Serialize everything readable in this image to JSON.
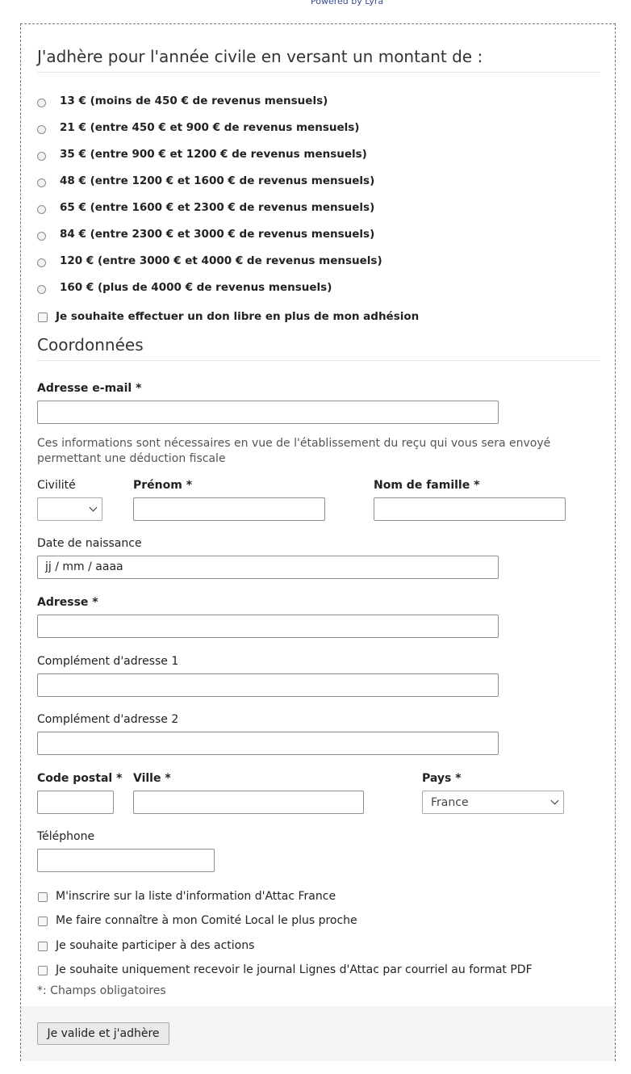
{
  "powered_by": "Powered by Lyra",
  "membership": {
    "heading": "J'adhère pour l'année civile en versant un montant de :",
    "options": [
      "13 € (moins de 450 € de revenus mensuels)",
      "21 € (entre 450 € et 900 € de revenus mensuels)",
      "35 € (entre 900 € et 1200 € de revenus mensuels)",
      "48 € (entre 1200 € et 1600 € de revenus mensuels)",
      "65 € (entre 1600 € et 2300 € de revenus mensuels)",
      "84 € (entre 2300 € et 3000 € de revenus mensuels)",
      "120 € (entre 3000 € et 4000 € de revenus mensuels)",
      "160 € (plus de 4000 € de revenus mensuels)"
    ],
    "don_libre_label": "Je souhaite effectuer un don libre en plus de mon adhésion"
  },
  "coordonnees": {
    "heading": "Coordonnées",
    "email_label": "Adresse e-mail *",
    "help_text": "Ces informations sont nécessaires en vue de l'établissement du reçu qui vous sera envoyé permettant une déduction fiscale",
    "civilite_label": "Civilité",
    "civilite_value": "",
    "prenom_label": "Prénom *",
    "nom_label": "Nom de famille *",
    "naissance_label": "Date de naissance",
    "naissance_placeholder": "jj / mm / aaaa",
    "adresse_label": "Adresse *",
    "complement1_label": "Complément d'adresse 1",
    "complement2_label": "Complément d'adresse 2",
    "cp_label": "Code postal *",
    "ville_label": "Ville *",
    "pays_label": "Pays *",
    "pays_value": "France",
    "telephone_label": "Téléphone"
  },
  "checkboxes": [
    "M'inscrire sur la liste d'information d'Attac France",
    "Me faire connaître à mon Comité Local le plus proche",
    "Je souhaite participer à des actions",
    "Je souhaite uniquement recevoir le journal Lignes d'Attac par courriel au format PDF"
  ],
  "required_note": "*: Champs obligatoires",
  "submit_label": "Je valide et j'adhère"
}
